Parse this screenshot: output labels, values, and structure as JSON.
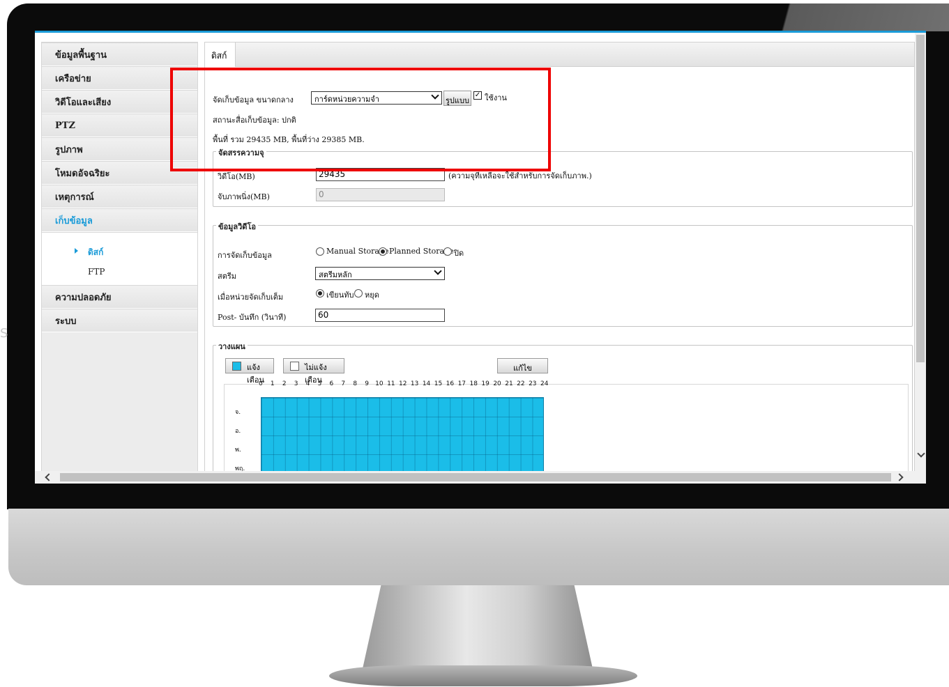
{
  "sidebar": {
    "items": [
      {
        "label": "ข้อมูลพื้นฐาน"
      },
      {
        "label": "เครือข่าย"
      },
      {
        "label": "วิดีโอและเสียง"
      },
      {
        "label": "PTZ"
      },
      {
        "label": "รูปภาพ"
      },
      {
        "label": "โหมดอัจฉริยะ"
      },
      {
        "label": "เหตุการณ์"
      },
      {
        "label": "เก็บข้อมูล"
      },
      {
        "label": "ความปลอดภัย"
      },
      {
        "label": "ระบบ"
      }
    ],
    "subitems": [
      {
        "label": "ดิสก์"
      },
      {
        "label": "FTP"
      }
    ]
  },
  "tab": {
    "label": "ดิสก์"
  },
  "storage": {
    "media_label": "จัดเก็บข้อมูล ขนาดกลาง",
    "media_value": "การ์ดหน่วยความจำ",
    "format_button": "รูปแบบ",
    "enable_label": "ใช้งาน",
    "enable_check": "✓",
    "status_text": "สถานะสื่อเก็บข้อมูล: ปกติ",
    "space_text": "พื้นที่ รวม 29435 MB, พื้นที่ว่าง 29385 MB."
  },
  "allocation": {
    "legend": "จัดสรรความจุ",
    "video_label": "วิดีโอ(MB)",
    "video_value": "29435",
    "video_note": "(ความจุที่เหลือจะใช้สำหรับการจัดเก็บภาพ.)",
    "snapshot_label": "จับภาพนิ่ง(MB)",
    "snapshot_value": "0"
  },
  "video": {
    "legend": "ข้อมูลวิดีโอ",
    "mode_label": "การจัดเก็บข้อมูล",
    "mode_options": [
      "Manual Storage",
      "Planned Storage",
      "ปิด"
    ],
    "mode_selected": "Planned Storage",
    "stream_label": "สตรีม",
    "stream_value": "สตรีมหลัก",
    "full_label": "เมื่อหน่วยจัดเก็บเต็ม",
    "full_options": [
      "เขียนทับ",
      "หยุด"
    ],
    "full_selected": "เขียนทับ",
    "post_label": "Post- บันทึก (วินาที)",
    "post_value": "60"
  },
  "schedule": {
    "legend": "วางแผน",
    "armed_button": "แจ้งเตือน",
    "disarmed_button": "ไม่แจ้งเตือน",
    "edit_button": "แก้ไข",
    "hours": [
      "0",
      "1",
      "2",
      "3",
      "4",
      "5",
      "6",
      "7",
      "8",
      "9",
      "10",
      "11",
      "12",
      "13",
      "14",
      "15",
      "16",
      "17",
      "18",
      "19",
      "20",
      "21",
      "22",
      "23",
      "24"
    ],
    "days": [
      "จ.",
      "อ.",
      "พ.",
      "พฤ."
    ],
    "armed_color": "#1bbde8"
  },
  "colors": {
    "accent": "#1a9bd8",
    "highlight": "#ee0000"
  },
  "ghost_text": "S"
}
